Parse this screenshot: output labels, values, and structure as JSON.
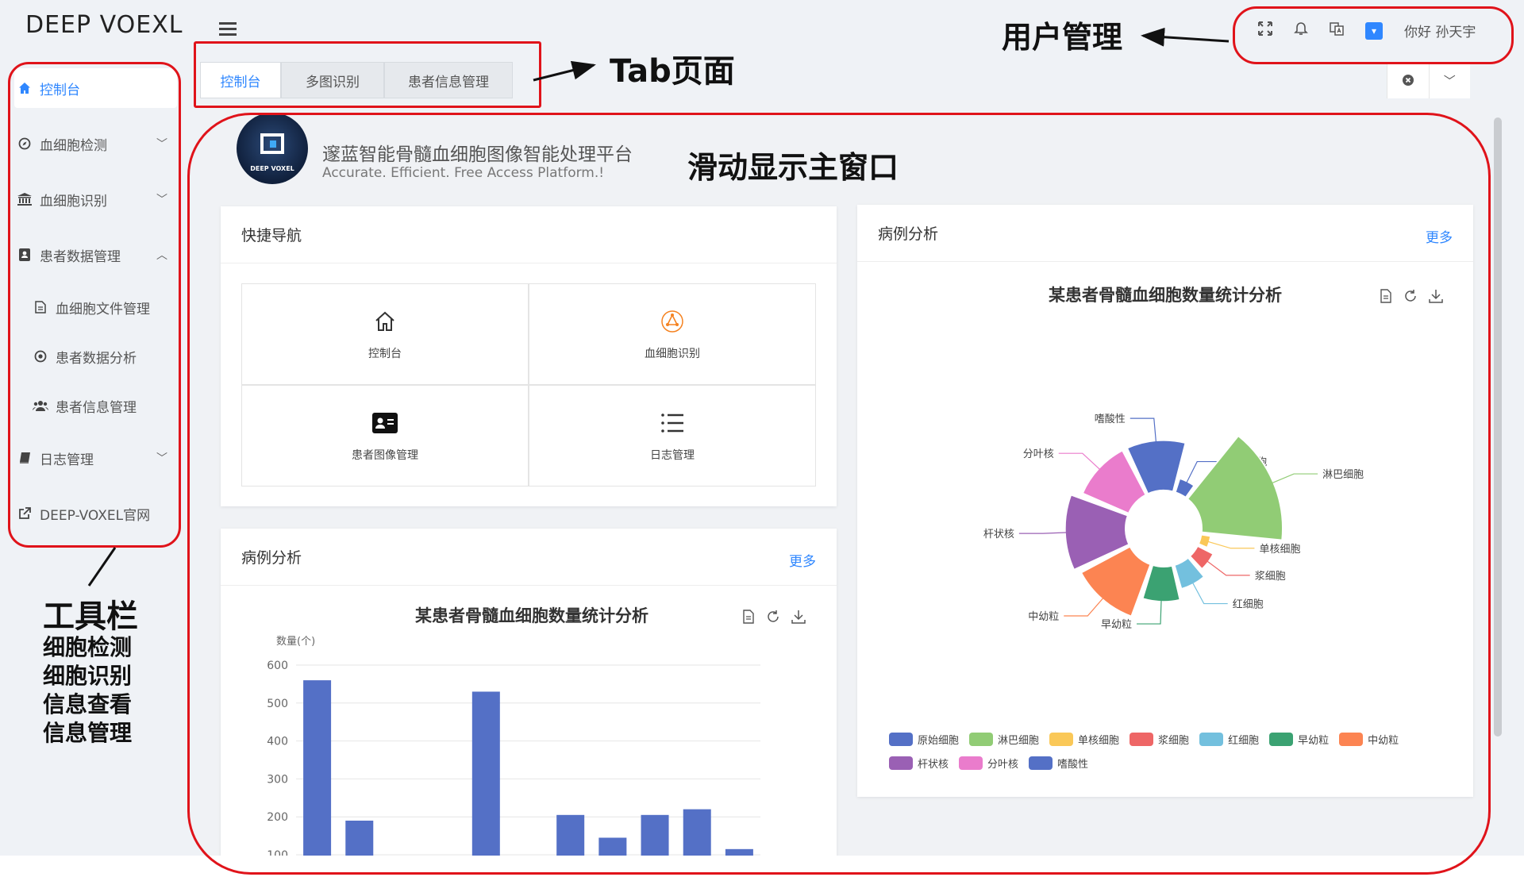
{
  "app": {
    "logo": "DEEP VOEXL"
  },
  "header": {
    "greeting": "你好 孙天宇"
  },
  "sidebar": {
    "items": [
      {
        "label": "控制台"
      },
      {
        "label": "血细胞检测"
      },
      {
        "label": "血细胞识别"
      },
      {
        "label": "患者数据管理"
      },
      {
        "label": "血细胞文件管理"
      },
      {
        "label": "患者数据分析"
      },
      {
        "label": "患者信息管理"
      },
      {
        "label": "日志管理"
      },
      {
        "label": "DEEP-VOXEL官网"
      }
    ]
  },
  "tabs": [
    {
      "label": "控制台"
    },
    {
      "label": "多图识别"
    },
    {
      "label": "患者信息管理"
    }
  ],
  "platform": {
    "logo_text": "DEEP VOXEL",
    "title": "邃蓝智能骨髓血细胞图像智能处理平台",
    "subtitle": "Accurate. Efficient. Free Access Platform.!"
  },
  "quick_nav": {
    "title": "快捷导航",
    "items": [
      {
        "label": "控制台"
      },
      {
        "label": "血细胞识别"
      },
      {
        "label": "患者图像管理"
      },
      {
        "label": "日志管理"
      }
    ]
  },
  "case_analysis": {
    "title": "病例分析",
    "more": "更多"
  },
  "annotations": {
    "user_mgmt": "用户管理",
    "tab_page": "Tab页面",
    "main_window": "滑动显示主窗口",
    "toolbar_title": "工具栏",
    "toolbar_lines": [
      "细胞检测",
      "细胞识别",
      "信息查看",
      "信息管理"
    ]
  },
  "colors": {
    "accent": "#2f87ff",
    "annotation": "#e0131a",
    "bar": "#5470c6"
  },
  "chart_data": [
    {
      "type": "bar",
      "title": "某患者骨髓血细胞数量统计分析",
      "ylabel": "数量(个)",
      "ylim": [
        100,
        600
      ],
      "yticks": [
        600,
        500,
        400,
        300,
        200,
        100
      ],
      "values": [
        560,
        190,
        0,
        0,
        530,
        0,
        205,
        145,
        205,
        220,
        115
      ],
      "grid": true
    },
    {
      "type": "pie",
      "subtype": "rose",
      "title": "某患者骨髓血细胞数量统计分析",
      "categories": [
        "原始细胞",
        "淋巴细胞",
        "单核细胞",
        "浆细胞",
        "红细胞",
        "早幼粒",
        "中幼粒",
        "杆状核",
        "分叶核",
        "嗜酸性"
      ],
      "values": [
        35,
        100,
        30,
        38,
        45,
        55,
        75,
        80,
        70,
        70
      ],
      "colors": [
        "#5470c6",
        "#91cc75",
        "#fac858",
        "#ee6666",
        "#73c0de",
        "#3ba272",
        "#fc8452",
        "#9a60b4",
        "#ea7ccc",
        "#5470c6"
      ],
      "legend": "bottom"
    }
  ]
}
